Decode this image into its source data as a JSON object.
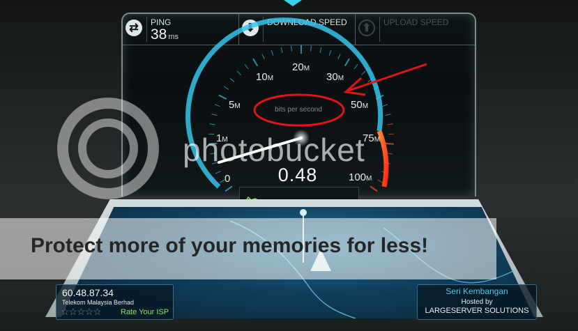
{
  "header": {
    "ping_label": "PING",
    "ping_value": "38",
    "ping_unit": "ms",
    "download_label": "DOWNLOAD SPEED",
    "upload_label": "UPLOAD SPEED"
  },
  "gauge": {
    "units_label": "bits per second",
    "current_value": "0.48",
    "current_value_num": 0.48,
    "ticks": [
      {
        "num": "0",
        "unit": ""
      },
      {
        "num": "1",
        "unit": "M"
      },
      {
        "num": "5",
        "unit": "M"
      },
      {
        "num": "10",
        "unit": "M"
      },
      {
        "num": "20",
        "unit": "M"
      },
      {
        "num": "30",
        "unit": "M"
      },
      {
        "num": "50",
        "unit": "M"
      },
      {
        "num": "75",
        "unit": "M"
      },
      {
        "num": "100",
        "unit": "M"
      }
    ],
    "accent_color": "#36c4ea",
    "high_range_color": "#ff5a2a"
  },
  "server": {
    "ip": "60.48.87.34",
    "isp": "Telekom Malaysia Berhad",
    "stars": "☆☆☆☆☆",
    "rate_label": "Rate Your ISP",
    "city": "Seri Kembangan",
    "hosted_by_label": "Hosted by",
    "host_name": "LARGESERVER SOLUTIONS"
  },
  "watermark": {
    "logo_text": "photobucket",
    "banner_text": "Protect more of your memories for less!"
  },
  "icons": {
    "ping": "ping-icon",
    "download": "download-icon",
    "upload": "upload-icon"
  }
}
